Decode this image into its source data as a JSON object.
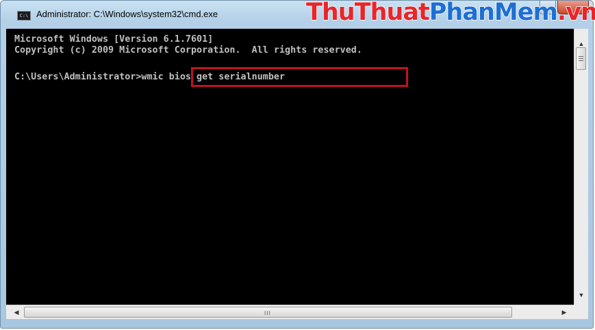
{
  "window": {
    "title": "Administrator: C:\\Windows\\system32\\cmd.exe",
    "app_icon_text": "C:\\"
  },
  "watermark": {
    "part1": "ThuThuat",
    "part2": "PhanMem",
    "part3": ".vn"
  },
  "console": {
    "lines": [
      "Microsoft Windows [Version 6.1.7601]",
      "Copyright (c) 2009 Microsoft Corporation.  All rights reserved.",
      "",
      "C:\\Users\\Administrator>wmic bios get serialnumber"
    ],
    "text_color": "#c0c0c0",
    "background": "#000000",
    "highlight_color": "#c1121f"
  },
  "scrollbars": {
    "up_arrow": "▲",
    "down_arrow": "▼",
    "left_arrow": "◀",
    "right_arrow": "▶",
    "grip": "III"
  }
}
